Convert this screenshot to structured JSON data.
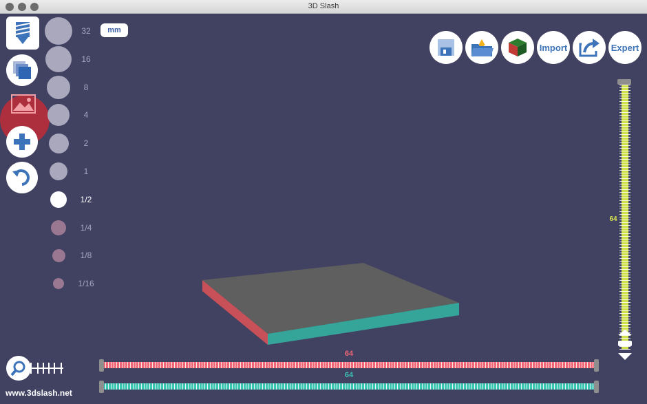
{
  "window": {
    "title": "3D Slash"
  },
  "left_toolbar": {
    "unit_label": "mm",
    "sizes": [
      {
        "label": "32",
        "dot_color": "#a9a8bd",
        "d": 40,
        "selected": false
      },
      {
        "label": "16",
        "dot_color": "#a9a8bd",
        "d": 38,
        "selected": false
      },
      {
        "label": "8",
        "dot_color": "#a9a8bd",
        "d": 34,
        "selected": false
      },
      {
        "label": "4",
        "dot_color": "#a9a8bd",
        "d": 32,
        "selected": false
      },
      {
        "label": "2",
        "dot_color": "#a9a8bd",
        "d": 29,
        "selected": false
      },
      {
        "label": "1",
        "dot_color": "#a9a8bd",
        "d": 26,
        "selected": false
      },
      {
        "label": "1/2",
        "dot_color": "#ffffff",
        "d": 24,
        "selected": true
      },
      {
        "label": "1/4",
        "dot_color": "#9a7892",
        "d": 22,
        "selected": false
      },
      {
        "label": "1/8",
        "dot_color": "#9a7892",
        "d": 19,
        "selected": false
      },
      {
        "label": "1/16",
        "dot_color": "#9a7892",
        "d": 16,
        "selected": false
      }
    ]
  },
  "top_toolbar": {
    "import_label": "Import",
    "expert_label": "Expert"
  },
  "sliders": {
    "vertical_value": "64",
    "horizontal_red_value": "64",
    "horizontal_teal_value": "64",
    "colors": {
      "vertical": "#cfe04a",
      "red": "#f06674",
      "teal": "#3cc4b4"
    }
  },
  "footer": {
    "site": "www.3dslash.net"
  }
}
